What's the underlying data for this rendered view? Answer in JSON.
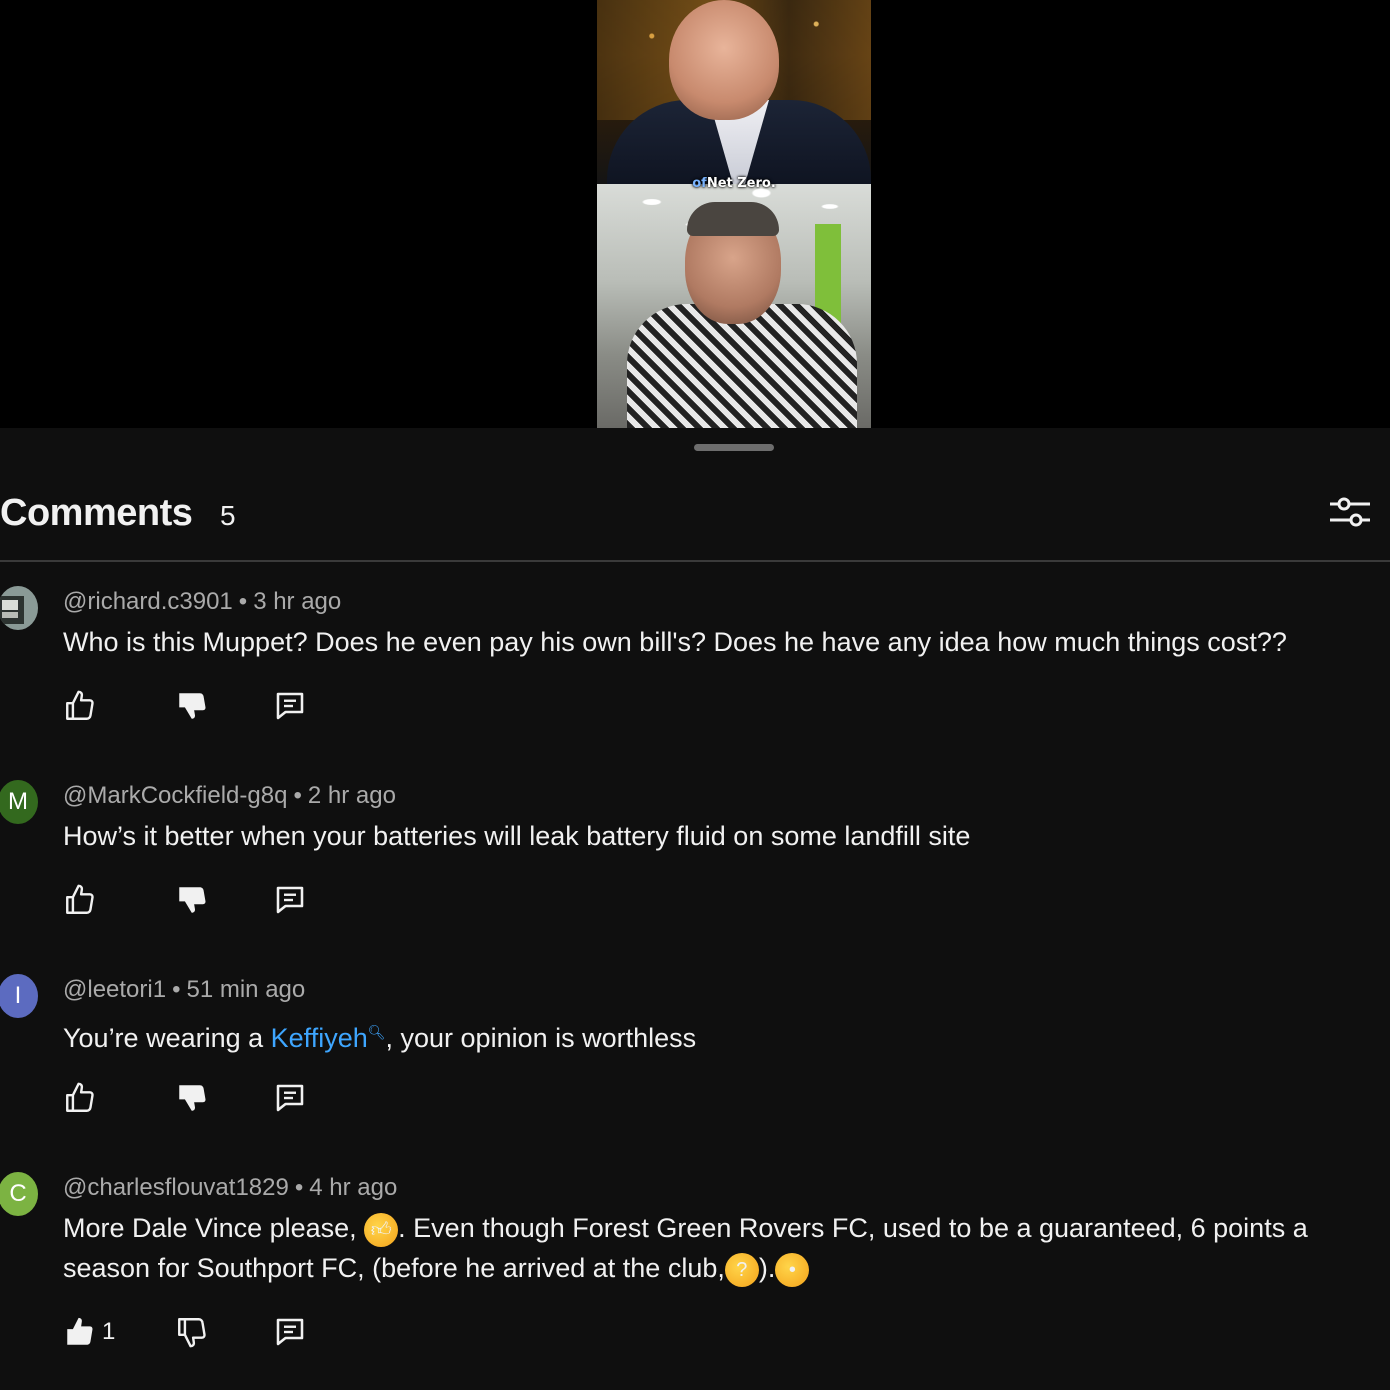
{
  "video": {
    "caption_highlight": "of",
    "caption_rest": "Net Zero."
  },
  "header": {
    "title": "Comments",
    "count": "5"
  },
  "comments": [
    {
      "author": "@richard.c3901",
      "time": "3 hr ago",
      "text": "Who is this Muppet? Does he even pay his own bill's? Does he have any idea how much things cost??",
      "avatar_letter": "",
      "avatar_color": "#5a6a6a",
      "likes": ""
    },
    {
      "author": "@MarkCockfield-g8q",
      "time": "2 hr ago",
      "text": "How’s it better when your batteries will leak battery fluid on some landfill site",
      "avatar_letter": "M",
      "avatar_color": "#33691e",
      "likes": ""
    },
    {
      "author": "@leetori1",
      "time": "51 min ago",
      "text_before": "You’re wearing a ",
      "text_link": "Keffiyeh",
      "text_after": ", your opinion is worthless",
      "avatar_letter": "I",
      "avatar_color": "#5c6bc0",
      "likes": ""
    },
    {
      "author": "@charlesflouvat1829",
      "time": "4 hr ago",
      "text_line1_a": "More Dale Vince please, ",
      "text_line1_b": ". Even though  Forest Green Rovers FC, used to be a guaranteed, 6 points a",
      "text_line2_a": "season for Southport FC, (before he arrived at the club,",
      "text_line2_b": ").",
      "emoji_thumbs": "thumbs-up-emoji",
      "emoji_thinking": "thinking-face-emoji",
      "emoji_shush": "face-with-hand-over-mouth-emoji",
      "avatar_letter": "C",
      "avatar_color": "#7cb342",
      "likes": "1"
    }
  ]
}
